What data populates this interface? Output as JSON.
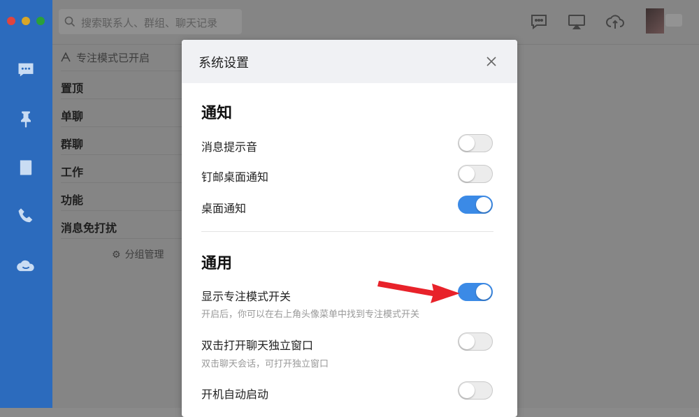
{
  "search": {
    "placeholder": "搜索联系人、群组、聊天记录"
  },
  "sidebar": {
    "icons": [
      "message-icon",
      "pin-icon",
      "contacts-icon",
      "phone-icon",
      "cloud-icon"
    ]
  },
  "topbar": {
    "icons": [
      "chat-icon",
      "screen-share-icon",
      "cloud-upload-icon"
    ]
  },
  "grouplist": {
    "focus_mode": "专注模式已开启",
    "items": [
      "置顶",
      "单聊",
      "群聊",
      "工作",
      "功能",
      "消息免打扰"
    ],
    "manage": "分组管理"
  },
  "dialog": {
    "title": "系统设置",
    "sections": [
      {
        "title": "通知",
        "options": [
          {
            "label": "消息提示音",
            "on": false
          },
          {
            "label": "钉邮桌面通知",
            "on": false
          },
          {
            "label": "桌面通知",
            "on": true
          }
        ]
      },
      {
        "title": "通用",
        "options": [
          {
            "label": "显示专注模式开关",
            "sub": "开启后，你可以在右上角头像菜单中找到专注模式开关",
            "on": true
          },
          {
            "label": "双击打开聊天独立窗口",
            "sub": "双击聊天会话，可打开独立窗口",
            "on": false
          },
          {
            "label": "开机自动启动",
            "on": false
          }
        ]
      }
    ]
  },
  "colors": {
    "toggle_on": "#3b8ae6",
    "sidebar": "#2c6bbd",
    "arrow": "#e8222a"
  }
}
